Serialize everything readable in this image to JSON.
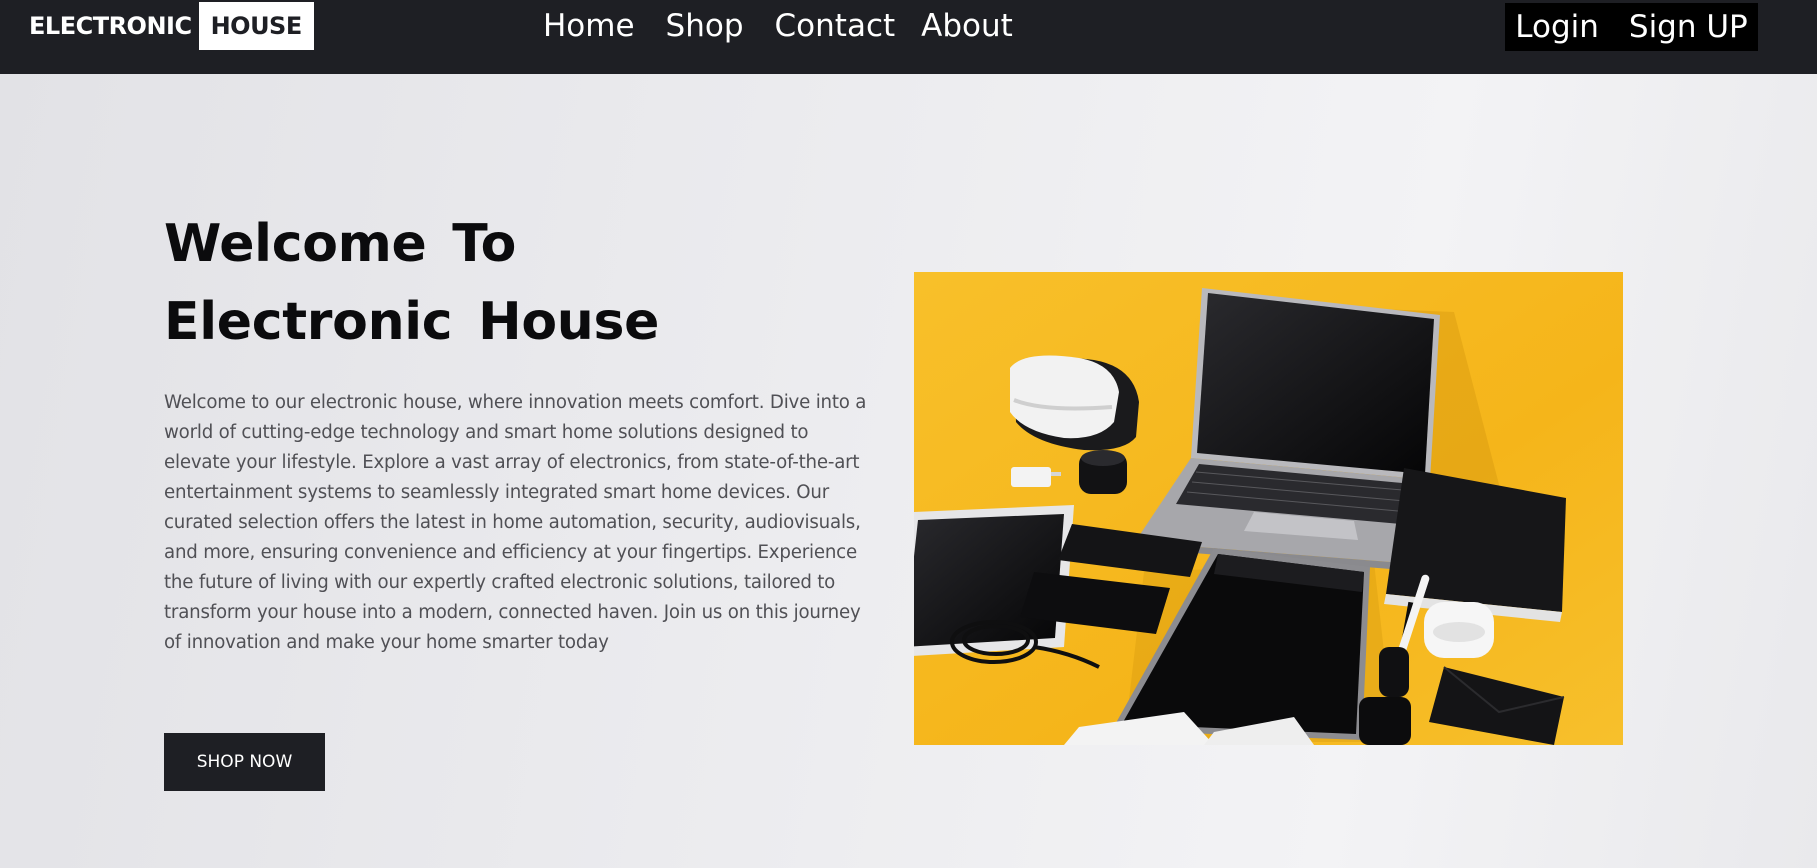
{
  "navbar": {
    "logo_part1": "ELECTRONIC",
    "logo_part2": "HOUSE",
    "links": [
      "Home",
      "Shop",
      "Contact",
      "About"
    ],
    "login_label": "Login",
    "signup_label": "Sign UP"
  },
  "hero": {
    "title": "Welcome To Electronic House",
    "description": "Welcome to our electronic house, where innovation meets comfort. Dive into a world of cutting-edge technology and smart home solutions designed to elevate your lifestyle. Explore a vast array of electronics, from state-of-the-art entertainment systems to seamlessly integrated smart home devices. Our curated selection offers the latest in home automation, security, audiovisuals, and more, ensuring convenience and efficiency at your fingertips. Experience the future of living with our expertly crafted electronic solutions, tailored to transform your house into a modern, connected haven. Join us on this journey of innovation and make your home smarter today",
    "cta_label": "SHOP NOW"
  },
  "colors": {
    "nav_background": "#1e1f24",
    "auth_background": "#000000",
    "image_background": "#f6b81c",
    "button_background": "#1e1f24"
  }
}
